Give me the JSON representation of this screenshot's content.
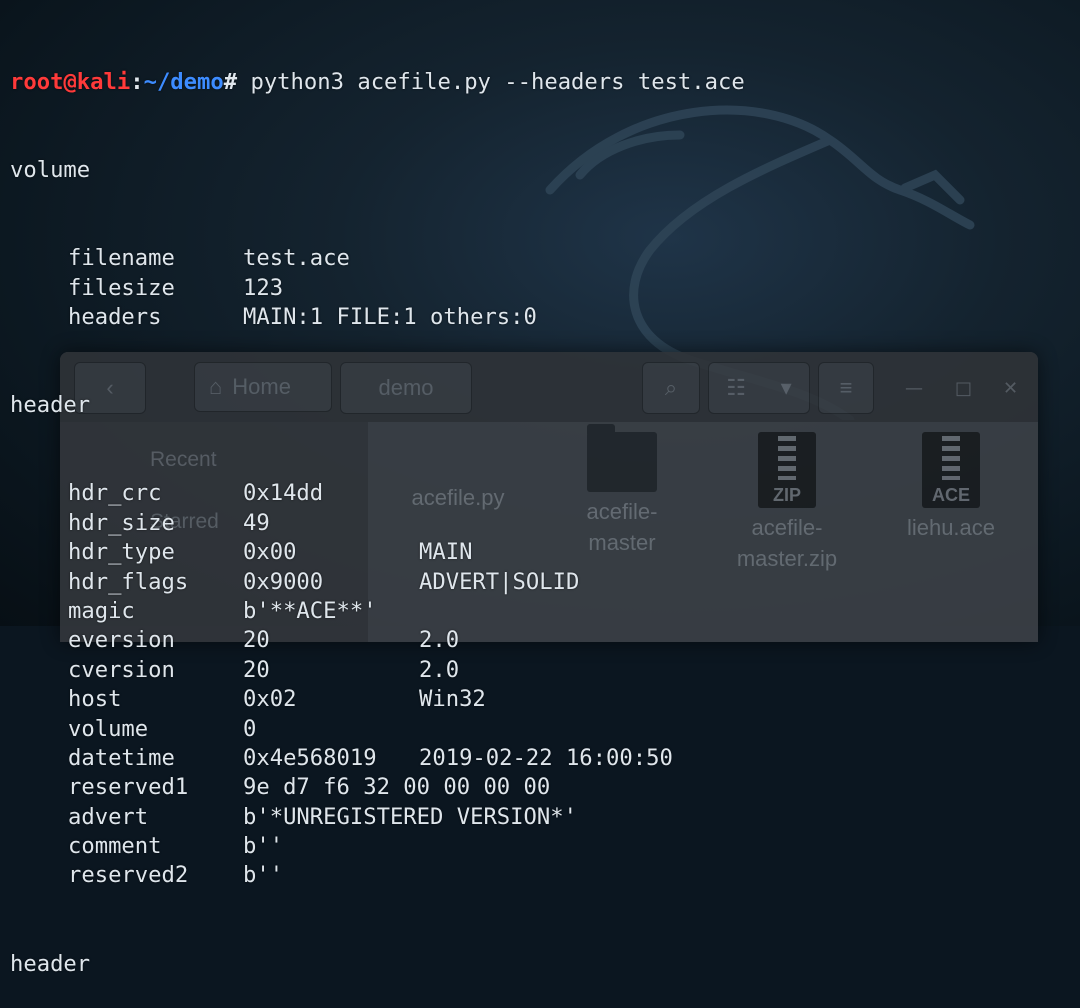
{
  "prompt": {
    "user_host": "root@kali",
    "sep": ":",
    "path": "~/demo",
    "symbol": "# ",
    "command": "python3 acefile.py --headers test.ace"
  },
  "file_manager": {
    "nav_home": "Home",
    "nav_demo": "demo",
    "sidebar": [
      "Recent",
      "Starred"
    ],
    "files": [
      {
        "name": "acefile.py",
        "icon": "python-file-icon"
      },
      {
        "name": "acefile-\nmaster",
        "icon": "folder-icon"
      },
      {
        "name": "acefile-\nmaster.zip",
        "icon": "zip-archive-icon",
        "badge": "ZIP"
      },
      {
        "name": "liehu.ace",
        "icon": "ace-archive-icon",
        "badge": "ACE"
      }
    ]
  },
  "output": {
    "volume_title": "volume",
    "volume": [
      {
        "key": "filename",
        "value": "test.ace"
      },
      {
        "key": "filesize",
        "value": "123"
      },
      {
        "key": "headers",
        "value": "MAIN:1 FILE:1 others:0"
      }
    ],
    "header_title": "header",
    "header": [
      {
        "key": "hdr_crc",
        "value": "0x14dd",
        "extra": ""
      },
      {
        "key": "hdr_size",
        "value": "49",
        "extra": ""
      },
      {
        "key": "hdr_type",
        "value": "0x00",
        "extra": "MAIN"
      },
      {
        "key": "hdr_flags",
        "value": "0x9000",
        "extra": "ADVERT|SOLID"
      },
      {
        "key": "magic",
        "value": "b'**ACE**'",
        "extra": ""
      },
      {
        "key": "eversion",
        "value": "20",
        "extra": "2.0"
      },
      {
        "key": "cversion",
        "value": "20",
        "extra": "2.0"
      },
      {
        "key": "host",
        "value": "0x02",
        "extra": "Win32"
      },
      {
        "key": "volume",
        "value": "0",
        "extra": ""
      },
      {
        "key": "datetime",
        "value": "0x4e568019",
        "extra": "2019-02-22 16:00:50"
      },
      {
        "key": "reserved1",
        "value": "9e d7 f6 32 00 00 00 00",
        "extra": ""
      },
      {
        "key": "advert",
        "value": "b'*UNREGISTERED VERSION*'",
        "extra": ""
      },
      {
        "key": "comment",
        "value": "b''",
        "extra": ""
      },
      {
        "key": "reserved2",
        "value": "b''",
        "extra": ""
      }
    ],
    "header2_title": "header"
  },
  "colors": {
    "user": "#ff3a3a",
    "path": "#3d8cff",
    "text": "#dfe6ec"
  }
}
